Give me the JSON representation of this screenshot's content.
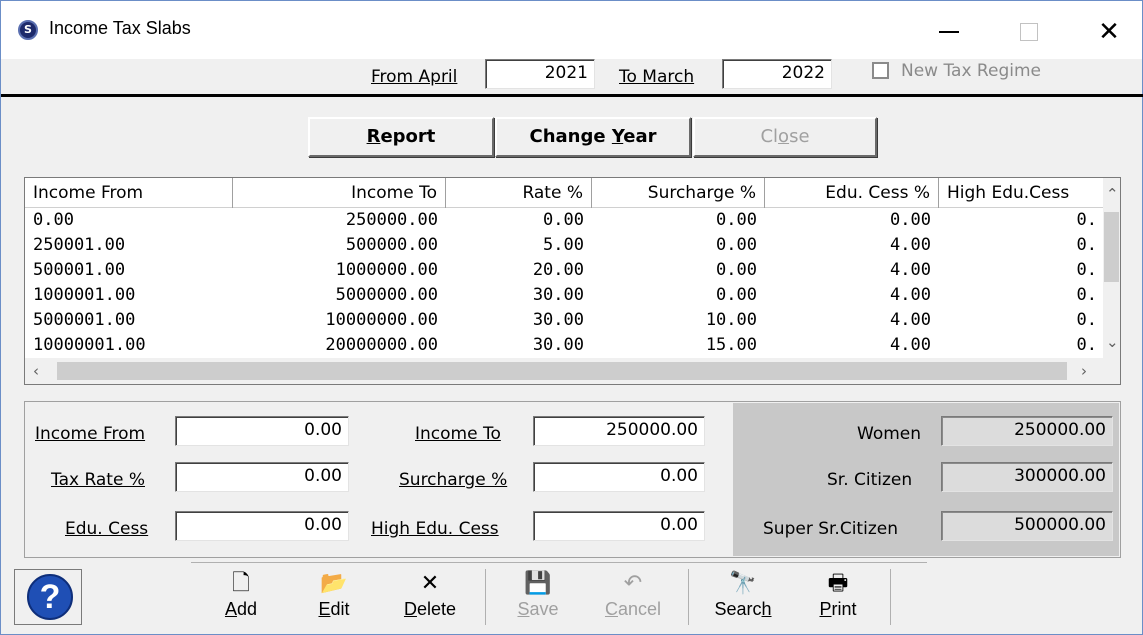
{
  "window": {
    "title": "Income Tax Slabs",
    "app_icon": "s-logo-icon",
    "controls": {
      "minimize": "minimize-icon",
      "maximize": "maximize-icon",
      "close": "✕"
    }
  },
  "year": {
    "from_label": "From April",
    "from_value": "2021",
    "to_label": "To March",
    "to_value": "2022",
    "new_regime_label": "New Tax Regime",
    "new_regime_checked": false
  },
  "actions": {
    "report_prefix": "",
    "report_key": "R",
    "report_rest": "eport",
    "change_year_prefix": "Change ",
    "change_year_key": "Y",
    "change_year_rest": "ear",
    "close_prefix": "Cl",
    "close_key": "o",
    "close_rest": "se"
  },
  "grid": {
    "columns": [
      "Income From",
      "Income To",
      "Rate %",
      "Surcharge %",
      "Edu. Cess %",
      "High Edu.Cess"
    ],
    "rows": [
      [
        "0.00",
        "250000.00",
        "0.00",
        "0.00",
        "0.00",
        "0."
      ],
      [
        "250001.00",
        "500000.00",
        "5.00",
        "0.00",
        "4.00",
        "0."
      ],
      [
        "500001.00",
        "1000000.00",
        "20.00",
        "0.00",
        "4.00",
        "0."
      ],
      [
        "1000001.00",
        "5000000.00",
        "30.00",
        "0.00",
        "4.00",
        "0."
      ],
      [
        "5000001.00",
        "10000000.00",
        "30.00",
        "10.00",
        "4.00",
        "0."
      ],
      [
        "10000001.00",
        "20000000.00",
        "30.00",
        "15.00",
        "4.00",
        "0."
      ]
    ]
  },
  "form": {
    "income_from_label": "Income From",
    "income_from_value": "0.00",
    "income_to_label": "Income To",
    "income_to_value": "250000.00",
    "tax_rate_label": "Tax Rate %",
    "tax_rate_value": "0.00",
    "surcharge_label": "Surcharge %",
    "surcharge_value": "0.00",
    "edu_cess_label": "Edu. Cess",
    "edu_cess_value": "0.00",
    "high_edu_cess_label": "High Edu. Cess",
    "high_edu_cess_value": "0.00"
  },
  "exemptions": {
    "women_label": "Women",
    "women_value": "250000.00",
    "sr_citizen_label": "Sr. Citizen",
    "sr_citizen_value": "300000.00",
    "super_sr_label": "Super Sr.Citizen",
    "super_sr_value": "500000.00"
  },
  "toolbar": {
    "help": "?",
    "add_key": "A",
    "add_rest": "dd",
    "edit_key": "E",
    "edit_rest": "dit",
    "delete_key": "D",
    "delete_rest": "elete",
    "save_key": "S",
    "save_rest": "ave",
    "cancel_key": "C",
    "cancel_rest": "ancel",
    "search_prefix": "Searc",
    "search_key": "h",
    "print_key": "P",
    "print_rest": "rint"
  },
  "colors": {
    "accent_border": "#6b8ec7",
    "panel_shade": "#c8c8c8",
    "help_blue": "#1f4fb5"
  }
}
